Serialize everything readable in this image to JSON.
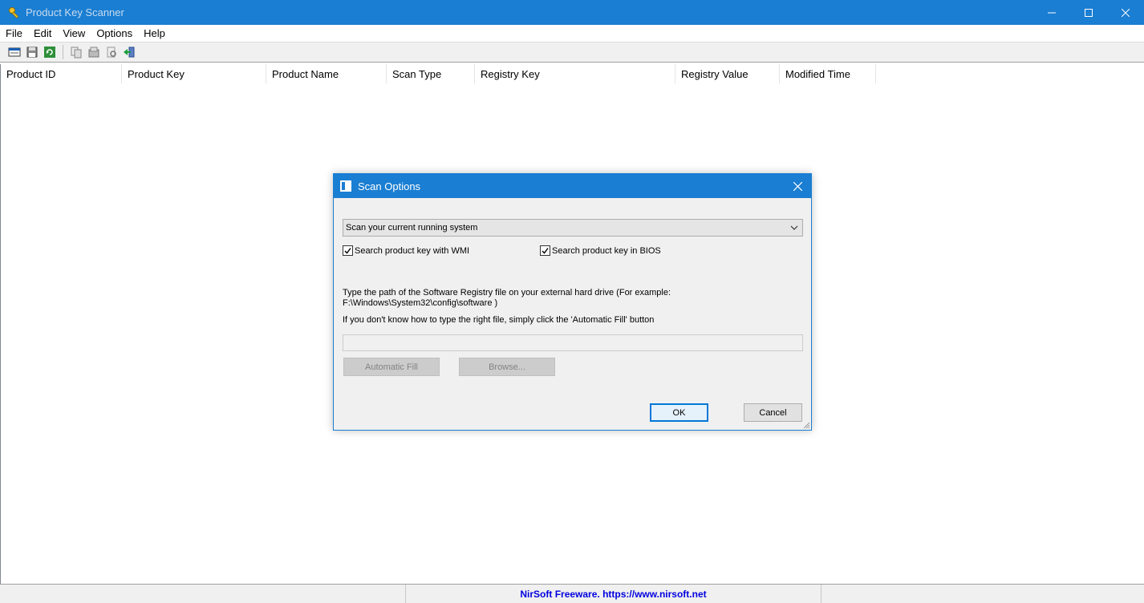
{
  "window": {
    "title": "Product Key Scanner",
    "icon": "key-scanner-icon",
    "controls": [
      "minimize-icon",
      "maximize-icon",
      "close-icon"
    ]
  },
  "menu": {
    "items": [
      "File",
      "Edit",
      "View",
      "Options",
      "Help"
    ]
  },
  "toolbar": {
    "buttons": [
      "scan-options-icon",
      "save-icon",
      "refresh-icon",
      "copy-icon",
      "properties-icon",
      "find-icon",
      "exit-icon"
    ]
  },
  "listview": {
    "columns": [
      "Product ID",
      "Product Key",
      "Product Name",
      "Scan Type",
      "Registry Key",
      "Registry Value",
      "Modified Time"
    ]
  },
  "statusbar": {
    "link_text": "NirSoft Freeware. https://www.nirsoft.net"
  },
  "dialog": {
    "title": "Scan Options",
    "scan_source": "Scan your current running system",
    "wmi_checkbox": {
      "label": "Search product key with WMI",
      "checked": true
    },
    "bios_checkbox": {
      "label": "Search product key in BIOS",
      "checked": true
    },
    "instruction_line1": "Type the path of the Software Registry file on your external hard drive (For example:",
    "instruction_line2": "F:\\Windows\\System32\\config\\software )",
    "hint": "If you don't know how to type the right file, simply click the 'Automatic Fill' button",
    "path_value": "",
    "automatic_fill_label": "Automatic Fill",
    "browse_label": "Browse...",
    "ok_label": "OK",
    "cancel_label": "Cancel"
  },
  "colors": {
    "titlebar": "#1a7ed2",
    "dialog_bg": "#f0f0f0",
    "status_link": "#0000e0"
  }
}
